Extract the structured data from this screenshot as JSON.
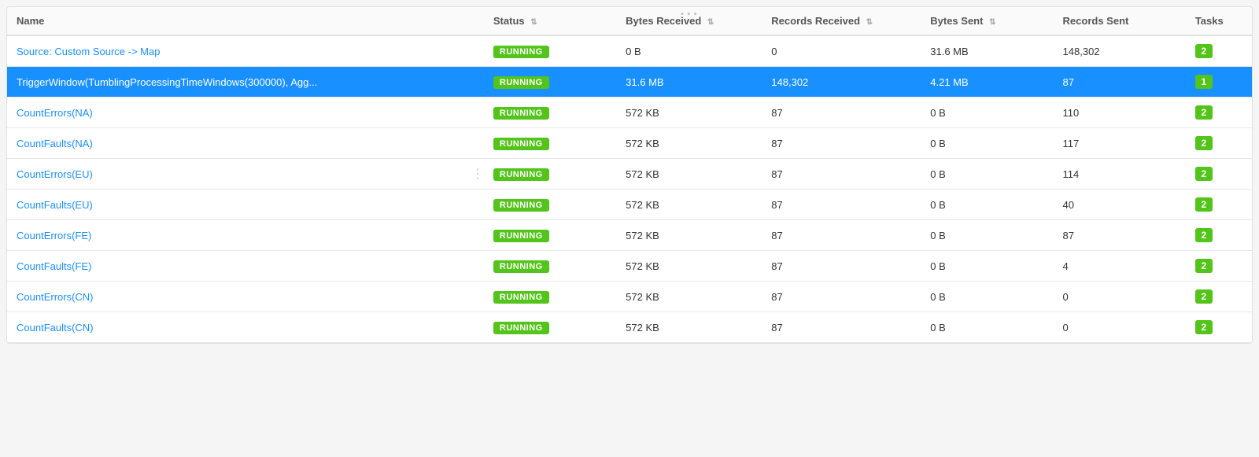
{
  "table": {
    "columns": [
      {
        "id": "name",
        "label": "Name",
        "sortable": false
      },
      {
        "id": "status",
        "label": "Status",
        "sortable": true
      },
      {
        "id": "bytes_received",
        "label": "Bytes Received",
        "sortable": true
      },
      {
        "id": "records_received",
        "label": "Records Received",
        "sortable": true
      },
      {
        "id": "bytes_sent",
        "label": "Bytes Sent",
        "sortable": true
      },
      {
        "id": "records_sent",
        "label": "Records Sent",
        "sortable": false
      },
      {
        "id": "tasks",
        "label": "Tasks",
        "sortable": false
      }
    ],
    "rows": [
      {
        "name": "Source: Custom Source -> Map",
        "status": "RUNNING",
        "bytes_received": "0 B",
        "records_received": "0",
        "bytes_sent": "31.6 MB",
        "records_sent": "148,302",
        "tasks": "2",
        "selected": false
      },
      {
        "name": "TriggerWindow(TumblingProcessingTimeWindows(300000), Agg...",
        "status": "RUNNING",
        "bytes_received": "31.6 MB",
        "records_received": "148,302",
        "bytes_sent": "4.21 MB",
        "records_sent": "87",
        "tasks": "1",
        "selected": true
      },
      {
        "name": "CountErrors(NA)",
        "status": "RUNNING",
        "bytes_received": "572 KB",
        "records_received": "87",
        "bytes_sent": "0 B",
        "records_sent": "110",
        "tasks": "2",
        "selected": false
      },
      {
        "name": "CountFaults(NA)",
        "status": "RUNNING",
        "bytes_received": "572 KB",
        "records_received": "87",
        "bytes_sent": "0 B",
        "records_sent": "117",
        "tasks": "2",
        "selected": false
      },
      {
        "name": "CountErrors(EU)",
        "status": "RUNNING",
        "bytes_received": "572 KB",
        "records_received": "87",
        "bytes_sent": "0 B",
        "records_sent": "114",
        "tasks": "2",
        "selected": false
      },
      {
        "name": "CountFaults(EU)",
        "status": "RUNNING",
        "bytes_received": "572 KB",
        "records_received": "87",
        "bytes_sent": "0 B",
        "records_sent": "40",
        "tasks": "2",
        "selected": false
      },
      {
        "name": "CountErrors(FE)",
        "status": "RUNNING",
        "bytes_received": "572 KB",
        "records_received": "87",
        "bytes_sent": "0 B",
        "records_sent": "87",
        "tasks": "2",
        "selected": false
      },
      {
        "name": "CountFaults(FE)",
        "status": "RUNNING",
        "bytes_received": "572 KB",
        "records_received": "87",
        "bytes_sent": "0 B",
        "records_sent": "4",
        "tasks": "2",
        "selected": false
      },
      {
        "name": "CountErrors(CN)",
        "status": "RUNNING",
        "bytes_received": "572 KB",
        "records_received": "87",
        "bytes_sent": "0 B",
        "records_sent": "0",
        "tasks": "2",
        "selected": false
      },
      {
        "name": "CountFaults(CN)",
        "status": "RUNNING",
        "bytes_received": "572 KB",
        "records_received": "87",
        "bytes_sent": "0 B",
        "records_sent": "0",
        "tasks": "2",
        "selected": false
      }
    ]
  }
}
